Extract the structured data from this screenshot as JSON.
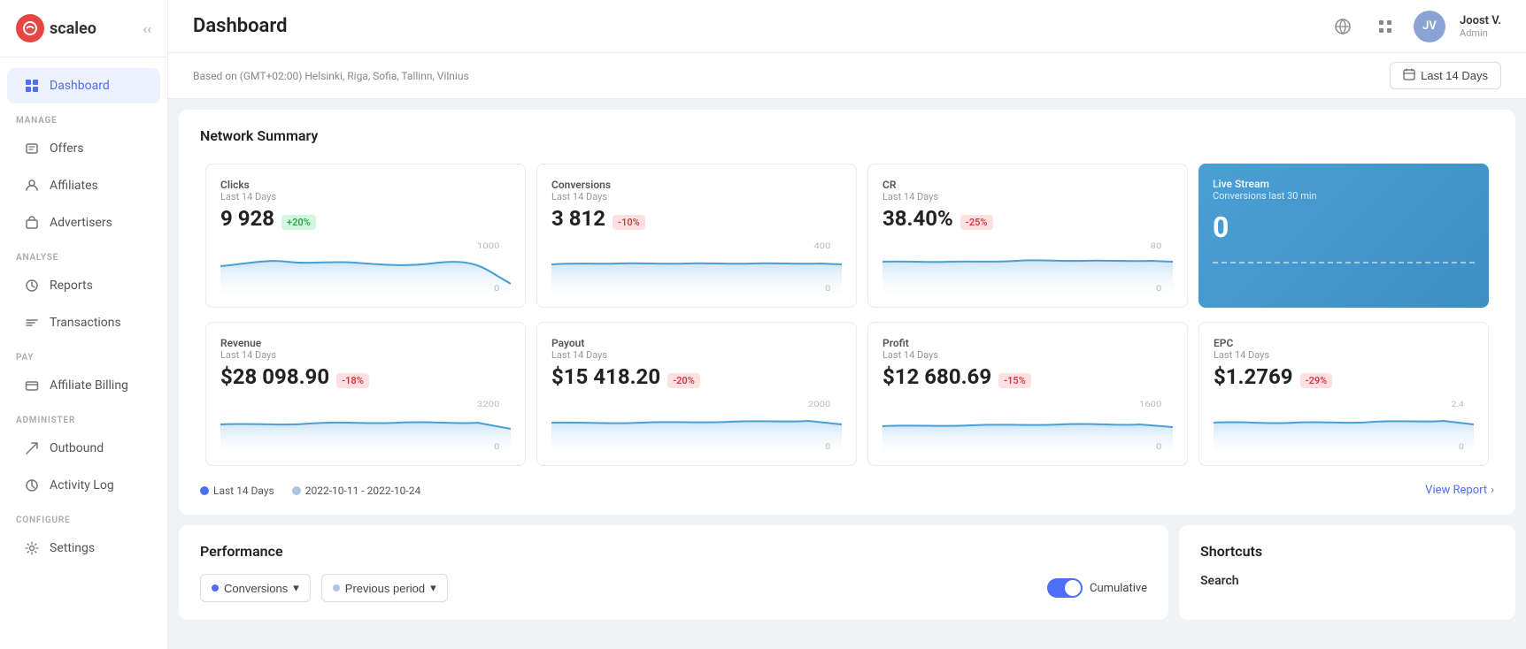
{
  "sidebar": {
    "logo": "scaleo",
    "nav_sections": [
      {
        "label": "MANAGE",
        "items": [
          {
            "id": "offers",
            "label": "Offers",
            "icon": "tag"
          },
          {
            "id": "affiliates",
            "label": "Affiliates",
            "icon": "person"
          },
          {
            "id": "advertisers",
            "label": "Advertisers",
            "icon": "briefcase"
          }
        ]
      },
      {
        "label": "ANALYSE",
        "items": [
          {
            "id": "reports",
            "label": "Reports",
            "icon": "chart"
          },
          {
            "id": "transactions",
            "label": "Transactions",
            "icon": "list"
          }
        ]
      },
      {
        "label": "PAY",
        "items": [
          {
            "id": "affiliate-billing",
            "label": "Affiliate Billing",
            "icon": "card"
          }
        ]
      },
      {
        "label": "ADMINISTER",
        "items": [
          {
            "id": "outbound",
            "label": "Outbound",
            "icon": "send"
          },
          {
            "id": "activity-log",
            "label": "Activity Log",
            "icon": "clock"
          }
        ]
      },
      {
        "label": "CONFIGURE",
        "items": [
          {
            "id": "settings",
            "label": "Settings",
            "icon": "gear"
          }
        ]
      }
    ]
  },
  "header": {
    "title": "Dashboard",
    "user": {
      "name": "Joost V.",
      "role": "Admin"
    }
  },
  "timezone": "Based on (GMT+02:00) Helsinki, Riga, Sofia, Tallinn, Vilnius",
  "date_range_btn": "Last 14 Days",
  "network_summary": {
    "title": "Network Summary",
    "metrics": [
      {
        "id": "clicks",
        "label": "Clicks",
        "period": "Last 14 Days",
        "value": "9 928",
        "badge": "+20%",
        "badge_type": "up",
        "chart_max": "1000"
      },
      {
        "id": "conversions",
        "label": "Conversions",
        "period": "Last 14 Days",
        "value": "3 812",
        "badge": "-10%",
        "badge_type": "down",
        "chart_max": "400"
      },
      {
        "id": "cr",
        "label": "CR",
        "period": "Last 14 Days",
        "value": "38.40%",
        "badge": "-25%",
        "badge_type": "down",
        "chart_max": "80"
      },
      {
        "id": "live-stream",
        "label": "Live Stream",
        "sub_label": "Conversions last 30 min",
        "value": "0",
        "type": "live"
      }
    ],
    "metrics2": [
      {
        "id": "revenue",
        "label": "Revenue",
        "period": "Last 14 Days",
        "value": "$28 098.90",
        "badge": "-18%",
        "badge_type": "down",
        "chart_max": "3200"
      },
      {
        "id": "payout",
        "label": "Payout",
        "period": "Last 14 Days",
        "value": "$15 418.20",
        "badge": "-20%",
        "badge_type": "down",
        "chart_max": "2000"
      },
      {
        "id": "profit",
        "label": "Profit",
        "period": "Last 14 Days",
        "value": "$12 680.69",
        "badge": "-15%",
        "badge_type": "down",
        "chart_max": "1600"
      },
      {
        "id": "epc",
        "label": "EPC",
        "period": "Last 14 Days",
        "value": "$1.2769",
        "badge": "-29%",
        "badge_type": "down",
        "chart_max": "2.4"
      }
    ]
  },
  "legend": {
    "current": "Last 14 Days",
    "previous": "2022-10-11 - 2022-10-24",
    "view_report": "View Report"
  },
  "performance": {
    "title": "Performance",
    "conversions_label": "Conversions",
    "previous_label": "Previous period",
    "cumulative_label": "Cumulative"
  },
  "shortcuts": {
    "title": "Shortcuts",
    "search_label": "Search"
  }
}
